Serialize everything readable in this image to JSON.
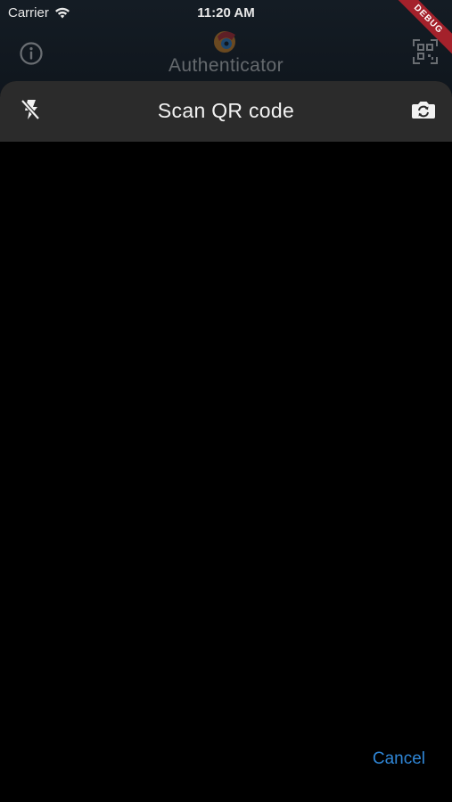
{
  "status_bar": {
    "carrier": "Carrier",
    "time": "11:20 AM"
  },
  "debug_banner": "DEBUG",
  "background_app": {
    "title": "Authenticator",
    "icons": [
      "info-icon",
      "app-logo-icon",
      "qr-code-icon"
    ]
  },
  "scanner": {
    "title": "Scan QR code",
    "cancel_label": "Cancel",
    "icons": [
      "flash-off-icon",
      "switch-camera-icon"
    ]
  },
  "colors": {
    "sheet_header": "#2b2b2b",
    "accent": "#2f86d6",
    "debug_ribbon": "#a4212b",
    "background": "#000000"
  }
}
